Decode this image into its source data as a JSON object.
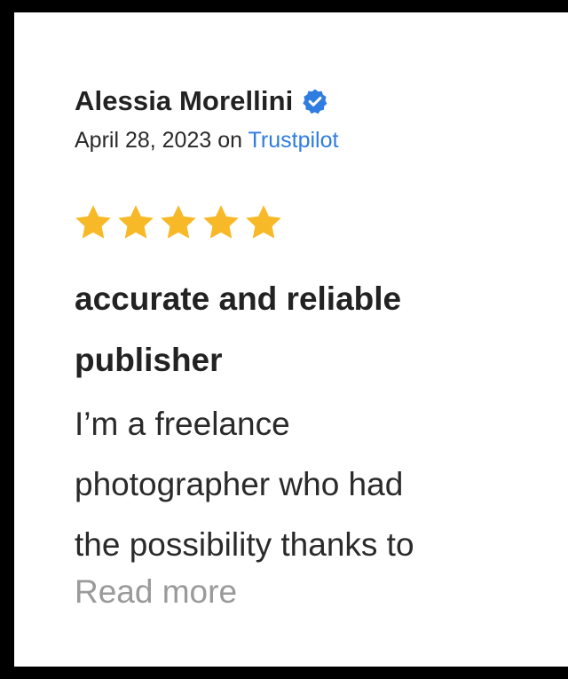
{
  "review": {
    "reviewer_name": "Alessia Morellini",
    "verified_icon": "verified-check-icon",
    "date": "April 28, 2023",
    "on_label": "on",
    "source": "Trustpilot",
    "rating": 5,
    "rating_max": 5,
    "title_line1": "accurate and reliable",
    "title_line2": "publisher",
    "body_line1": "I’m a freelance",
    "body_line2": "photographer who had",
    "body_line3": "the possibility thanks to",
    "read_more": "Read more"
  },
  "colors": {
    "background": "#000000",
    "card": "#ffffff",
    "star": "#f7b927",
    "verified": "#2f7de1",
    "link": "#2f7de1",
    "muted": "#9a9a9a"
  }
}
